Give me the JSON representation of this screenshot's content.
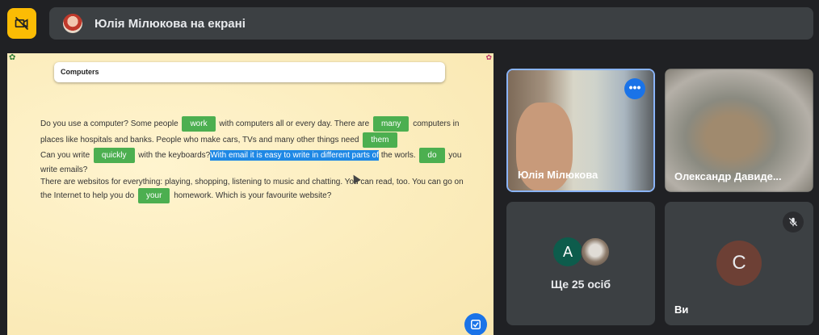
{
  "header": {
    "camera_icon": "camera-off-icon",
    "presenter_text": "Юлія Мілюкова на екрані"
  },
  "share": {
    "title": "Computers",
    "lines": {
      "l1a": "Do you use a computer? Some people",
      "c1": "work",
      "l1b": "with computers all or every day. There are",
      "c2": "many",
      "l1c": "computers in",
      "l2a": "places like hospitals and banks. People who make cars, TVs and many other things need",
      "c3": "them",
      "l3a": "Can you write",
      "c4": "quickly",
      "l3b": "with the keyboards?",
      "l3hl": "With email it is easy to write in different parts of",
      "l3c": "the worls.",
      "c5": "do",
      "l3d": "you",
      "l4a": "write emails?",
      "l5a": "There are websitos for everything: playing, shopping, listening to music and chatting. You can read, too. You can go on",
      "l6a": "the Internet to help you do",
      "c6": "your",
      "l6b": "homework. Which is your favourite website?"
    }
  },
  "tiles": {
    "t1_name": "Юлія Мілюкова",
    "t1_more": "•••",
    "t2_name": "Олександр Давиде...",
    "t3_avatar_letter": "A",
    "t3_count": "Ще 25 осіб",
    "t4_avatar_letter": "C",
    "t4_name": "Ви"
  },
  "colors": {
    "accent": "#1a73e8",
    "chip": "#4caf50",
    "warning": "#fbbc04"
  }
}
